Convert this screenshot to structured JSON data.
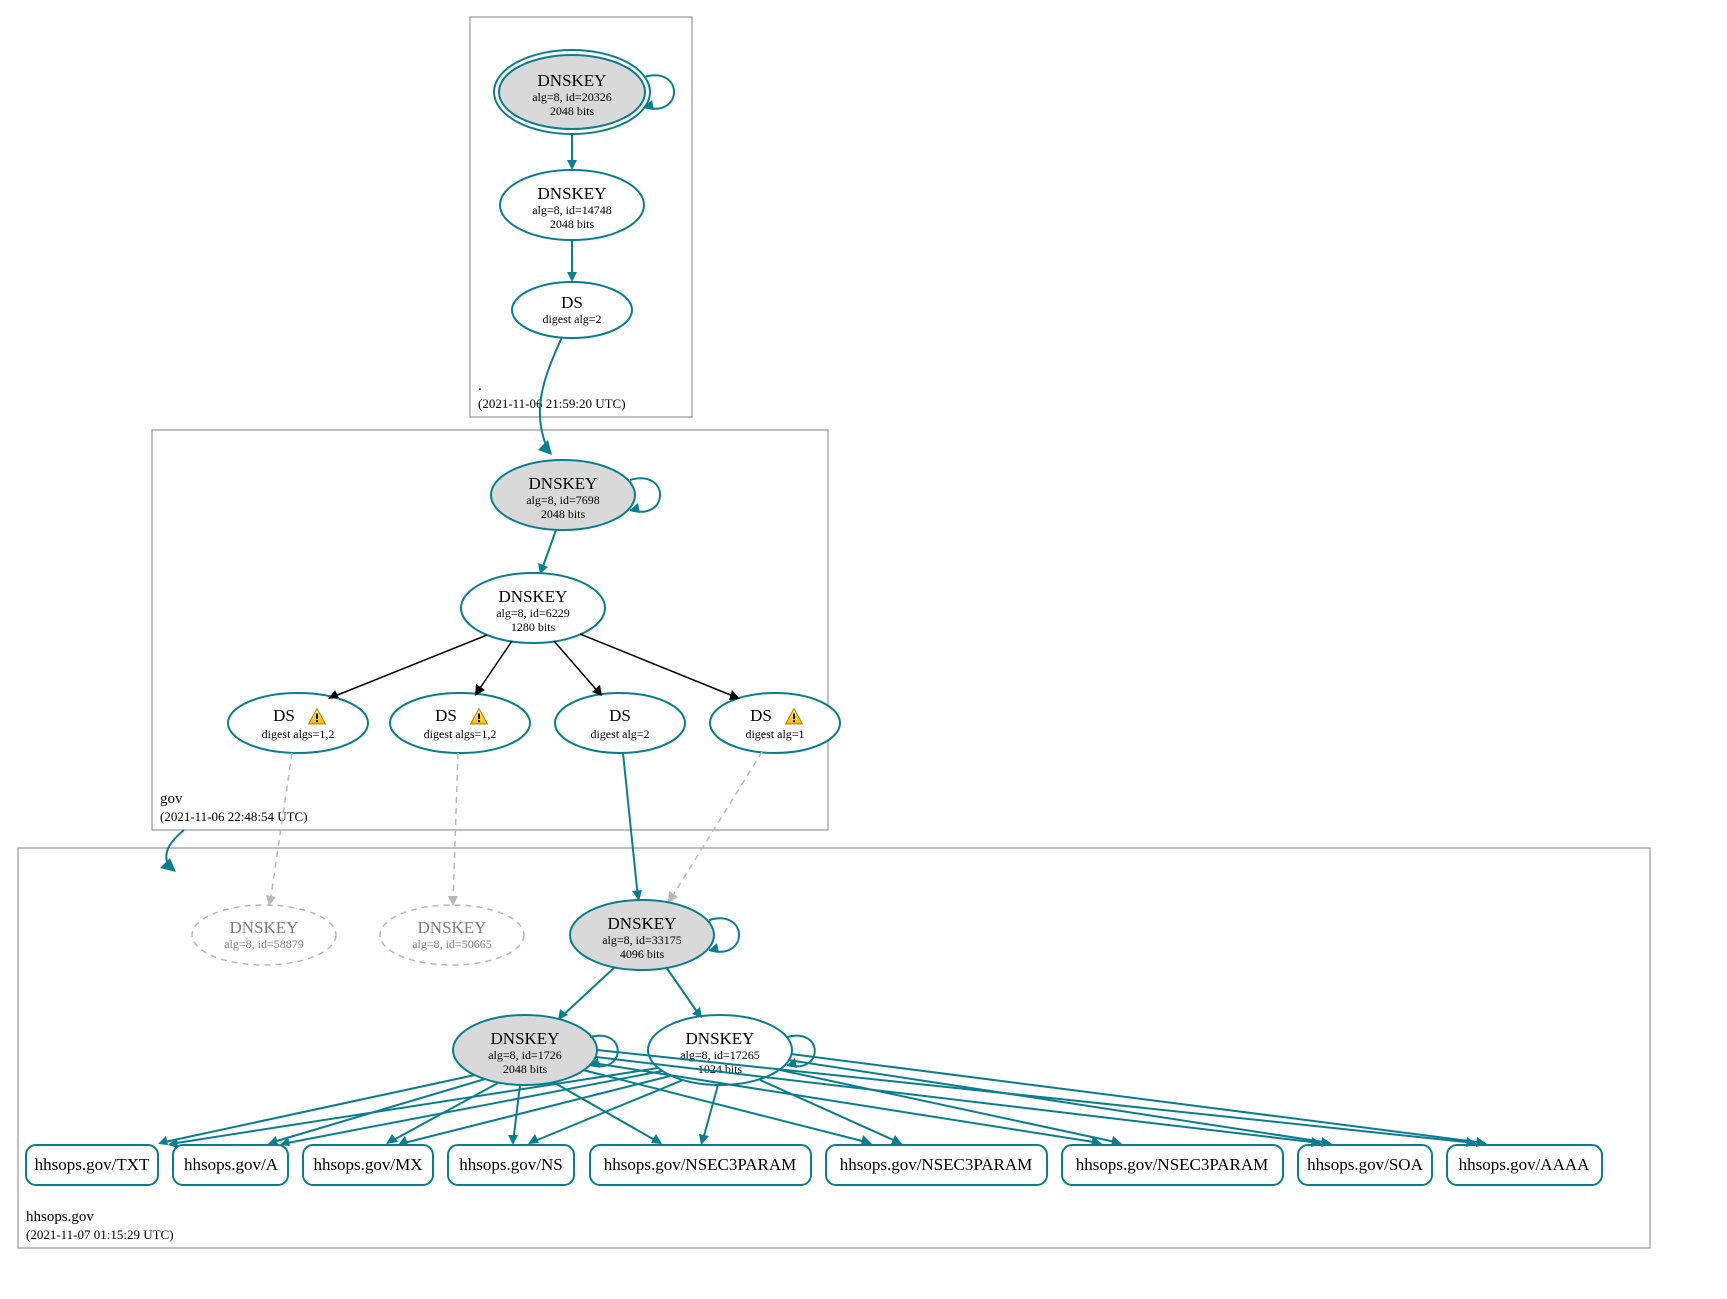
{
  "colors": {
    "accent": "#0a7e8c",
    "node_fill_grey": "#d9d9d9",
    "box_stroke": "#808080",
    "dashed_grey": "#b8b8b8"
  },
  "zones": {
    "root": {
      "name": ".",
      "timestamp": "(2021-11-06 21:59:20 UTC)"
    },
    "gov": {
      "name": "gov",
      "timestamp": "(2021-11-06 22:48:54 UTC)"
    },
    "hhsops": {
      "name": "hhsops.gov",
      "timestamp": "(2021-11-07 01:15:29 UTC)"
    }
  },
  "nodes": {
    "root_ksk": {
      "title": "DNSKEY",
      "line2": "alg=8, id=20326",
      "line3": "2048 bits"
    },
    "root_zsk": {
      "title": "DNSKEY",
      "line2": "alg=8, id=14748",
      "line3": "2048 bits"
    },
    "root_ds": {
      "title": "DS",
      "line2": "digest alg=2",
      "line3": ""
    },
    "gov_ksk": {
      "title": "DNSKEY",
      "line2": "alg=8, id=7698",
      "line3": "2048 bits"
    },
    "gov_zsk": {
      "title": "DNSKEY",
      "line2": "alg=8, id=6229",
      "line3": "1280 bits"
    },
    "gov_ds1": {
      "title": "DS",
      "line2": "digest algs=1,2",
      "line3": ""
    },
    "gov_ds2": {
      "title": "DS",
      "line2": "digest algs=1,2",
      "line3": ""
    },
    "gov_ds3": {
      "title": "DS",
      "line2": "digest alg=2",
      "line3": ""
    },
    "gov_ds4": {
      "title": "DS",
      "line2": "digest alg=1",
      "line3": ""
    },
    "hhs_dnskey_dashed1": {
      "title": "DNSKEY",
      "line2": "alg=8, id=58879",
      "line3": ""
    },
    "hhs_dnskey_dashed2": {
      "title": "DNSKEY",
      "line2": "alg=8, id=50665",
      "line3": ""
    },
    "hhs_ksk": {
      "title": "DNSKEY",
      "line2": "alg=8, id=33175",
      "line3": "4096 bits"
    },
    "hhs_zsk1": {
      "title": "DNSKEY",
      "line2": "alg=8, id=1726",
      "line3": "2048 bits"
    },
    "hhs_zsk2": {
      "title": "DNSKEY",
      "line2": "alg=8, id=17265",
      "line3": "1024 bits"
    }
  },
  "rrsets": {
    "txt": "hhsops.gov/TXT",
    "a": "hhsops.gov/A",
    "mx": "hhsops.gov/MX",
    "ns": "hhsops.gov/NS",
    "nsec3p_1": "hhsops.gov/NSEC3PARAM",
    "nsec3p_2": "hhsops.gov/NSEC3PARAM",
    "nsec3p_3": "hhsops.gov/NSEC3PARAM",
    "soa": "hhsops.gov/SOA",
    "aaaa": "hhsops.gov/AAAA"
  }
}
